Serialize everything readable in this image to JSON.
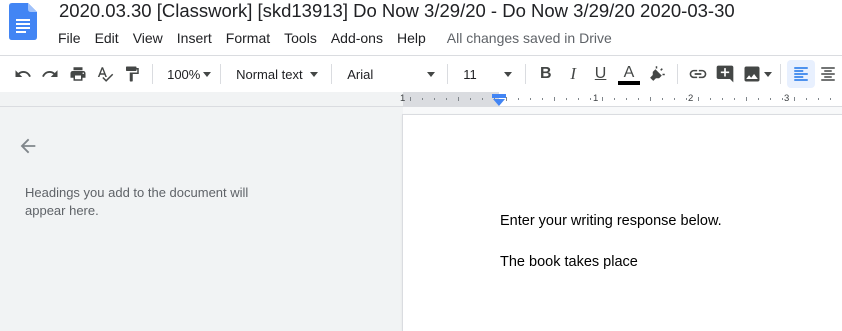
{
  "header": {
    "title": "2020.03.30 [Classwork] [skd13913] Do Now 3/29/20 - Do Now 3/29/20 2020-03-30",
    "save_status": "All changes saved in Drive",
    "menu": [
      "File",
      "Edit",
      "View",
      "Insert",
      "Format",
      "Tools",
      "Add-ons",
      "Help"
    ]
  },
  "toolbar": {
    "zoom": "100%",
    "style": "Normal text",
    "font": "Arial",
    "font_size": "11",
    "bold": "B",
    "italic": "I",
    "underline": "U",
    "text_color": "A",
    "icons": [
      "undo-icon",
      "redo-icon",
      "print-icon",
      "spellcheck-icon",
      "paint-format-icon",
      "bold-icon",
      "italic-icon",
      "underline-icon",
      "text-color-icon",
      "highlight-icon",
      "link-icon",
      "comment-icon",
      "image-icon",
      "align-left-icon",
      "align-center-icon"
    ],
    "text_color_hex": "#000000",
    "active_color": "#1a73e8"
  },
  "ruler": {
    "labels": [
      "1",
      "1",
      "2",
      "3"
    ]
  },
  "outline": {
    "hint": "Headings you add to the document will appear here."
  },
  "document": {
    "lines": [
      "Enter your writing response below.",
      "The book takes place"
    ]
  }
}
